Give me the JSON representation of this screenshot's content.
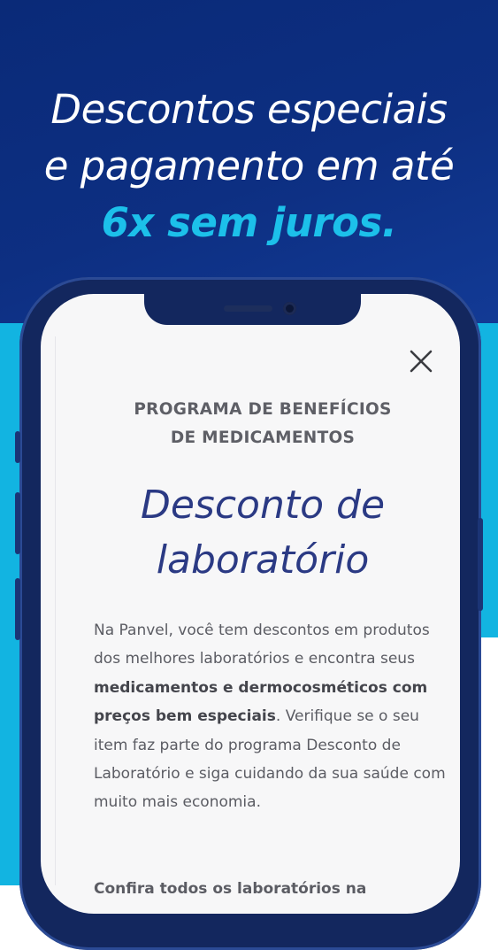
{
  "headline": {
    "line1": "Descontos especiais",
    "line2": "e pagamento em até",
    "accent": "6x sem juros."
  },
  "colors": {
    "navy": "#0d2f82",
    "cyan": "#12b4e1",
    "accent_text": "#1cc0ea",
    "title": "#2b3a84"
  },
  "modal": {
    "close_icon": "close-icon",
    "eyebrow_line1": "PROGRAMA DE BENEFÍCIOS",
    "eyebrow_line2": "DE MEDICAMENTOS",
    "title_line1": "Desconto de",
    "title_line2": "laboratório",
    "body": {
      "p1": "Na Panvel, você tem descontos em produtos dos melhores laboratórios e encontra seus ",
      "bold": "medicamentos e dermocosméticos com preços bem especiais",
      "p2": ". Verifique se o seu item faz parte do programa Desconto de Laboratório e siga cuidando da sua saúde com muito mais economia."
    },
    "cut_off_text": "Confira  todos  os  laboratórios  na"
  }
}
